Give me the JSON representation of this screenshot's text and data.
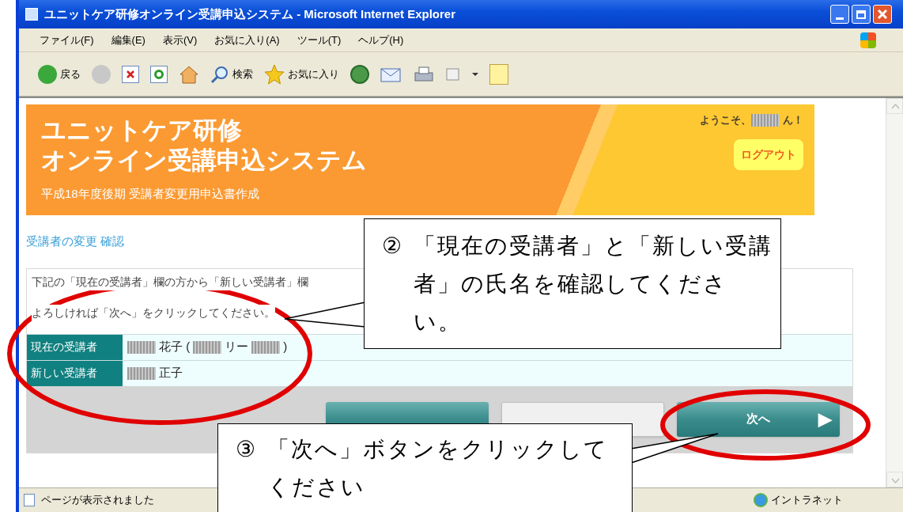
{
  "window": {
    "title": "ユニットケア研修オンライン受講申込システム - Microsoft Internet Explorer"
  },
  "menu": [
    "ファイル(F)",
    "編集(E)",
    "表示(V)",
    "お気に入り(A)",
    "ツール(T)",
    "ヘルプ(H)"
  ],
  "toolbar": {
    "back": "戻る",
    "search": "検索",
    "favorites": "お気に入り"
  },
  "banner": {
    "title_lines": [
      "ユニットケア研修",
      "オンライン受講申込システム"
    ],
    "subtitle": "平成18年度後期 受講者変更用申込書作成",
    "welcome": "ようこそ、",
    "welcome_suffix": "ん！",
    "logout": "ログアウト"
  },
  "heading": "受講者の変更 確認",
  "instructions": [
    "下記の「現在の受講者」欄の方から「新しい受講者」欄",
    "よろしければ「次へ」をクリックしてください。"
  ],
  "rows": [
    {
      "label": "現在の受講者",
      "parts": [
        {
          "kind": "redacted"
        },
        {
          "kind": "text",
          "text": "花子 ("
        },
        {
          "kind": "redacted"
        },
        {
          "kind": "text",
          "text": "リー"
        },
        {
          "kind": "redacted"
        },
        {
          "kind": "text",
          "text": ")"
        }
      ]
    },
    {
      "label": "新しい受講者",
      "parts": [
        {
          "kind": "redacted"
        },
        {
          "kind": "text",
          "text": "正子"
        }
      ]
    }
  ],
  "buttons": [
    {
      "kind": "primary"
    },
    {
      "kind": "secondary"
    },
    {
      "kind": "primary",
      "label": "次へ",
      "arrow": "▶"
    }
  ],
  "status_bar": {
    "text": "ページが表示されました",
    "zone": "イントラネット"
  },
  "callouts": [
    {
      "number": "②",
      "text": "「現在の受講者」と「新しい受講者」の氏名を確認してください。"
    },
    {
      "number": "③",
      "text": "「次へ」ボタンをクリックしてください"
    }
  ]
}
